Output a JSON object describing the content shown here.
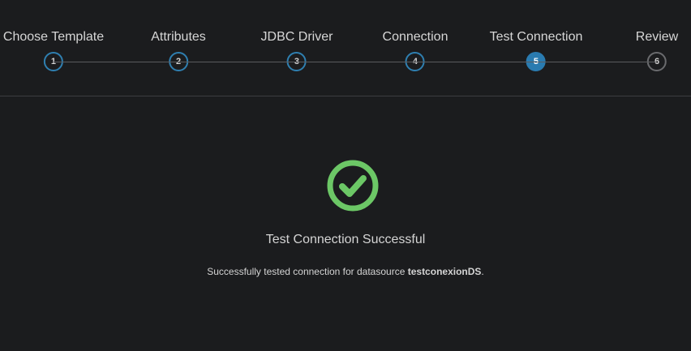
{
  "wizard": {
    "steps": [
      {
        "label": "Choose Template",
        "number": "1",
        "state": "done"
      },
      {
        "label": "Attributes",
        "number": "2",
        "state": "done"
      },
      {
        "label": "JDBC Driver",
        "number": "3",
        "state": "done"
      },
      {
        "label": "Connection",
        "number": "4",
        "state": "done"
      },
      {
        "label": "Test Connection",
        "number": "5",
        "state": "active"
      },
      {
        "label": "Review",
        "number": "6",
        "state": "pending"
      }
    ]
  },
  "result": {
    "icon": "check-circle-icon",
    "icon_color": "#6cc766",
    "title": "Test Connection Successful",
    "message_prefix": "Successfully tested connection for datasource ",
    "datasource": "testconexionDS",
    "message_suffix": "."
  },
  "colors": {
    "background": "#1b1c1e",
    "accent": "#2a7bb0",
    "success": "#6cc766"
  }
}
